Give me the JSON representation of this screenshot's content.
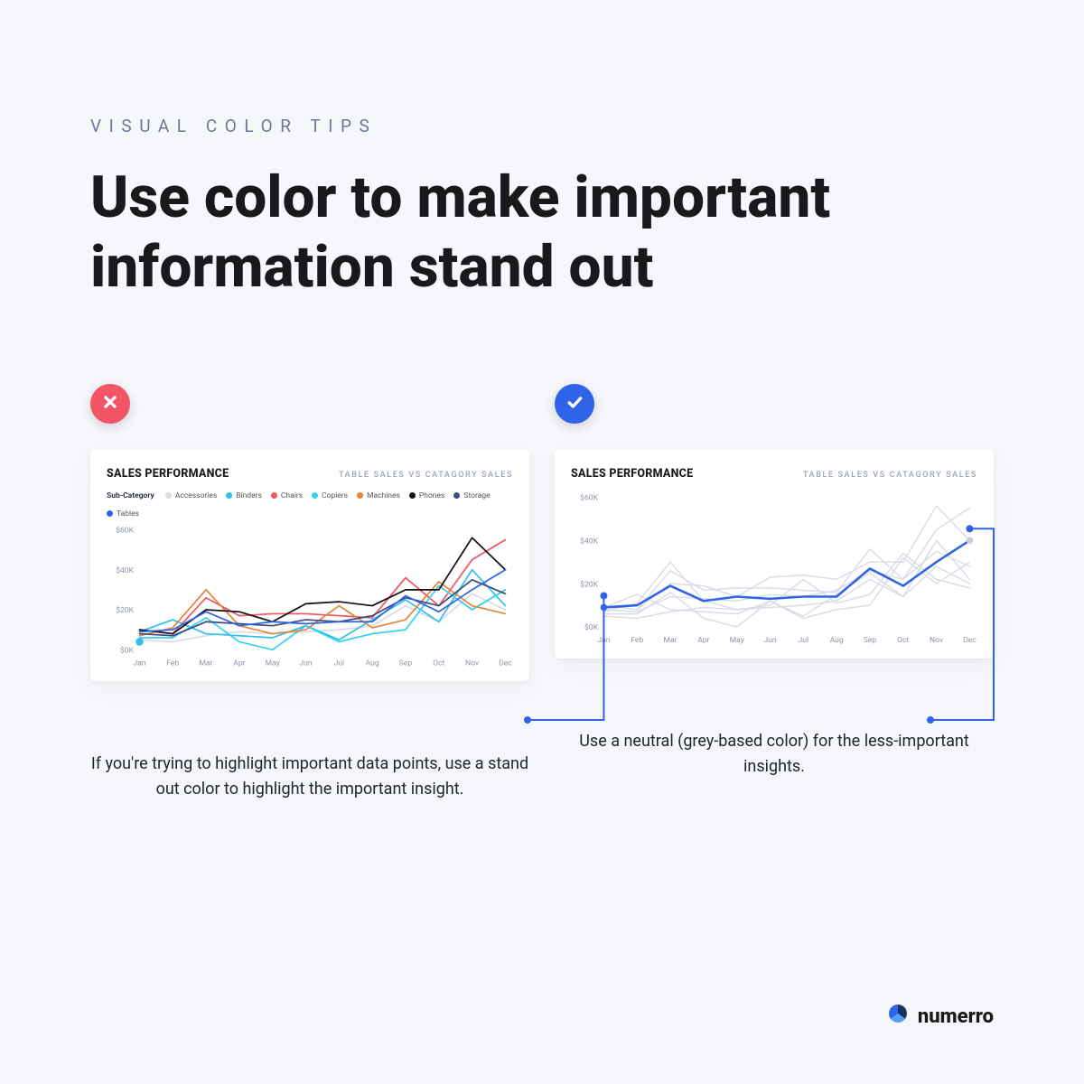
{
  "eyebrow": "VISUAL COLOR TIPS",
  "headline": "Use color to make important information stand out",
  "chart": {
    "title": "SALES PERFORMANCE",
    "subtitle": "TABLE SALES VS CATAGORY SALES",
    "legend_label": "Sub-Category"
  },
  "left": {
    "caption": "If you're trying to highlight important data points, use a stand out color to highlight the important insight."
  },
  "right": {
    "caption": "Use a neutral (grey-based color) for the less-important insights."
  },
  "brand": "numerro",
  "series_colors": {
    "Accessories": "#d7dbe6",
    "Binders": "#2fc1e9",
    "Chairs": "#f15566",
    "Copiers": "#35d0ee",
    "Machines": "#e6843a",
    "Phones": "#111111",
    "Storage": "#3f4c7a",
    "Tables": "#2f63e9"
  },
  "chart_data": {
    "type": "line",
    "title": "Sales Performance — Table Sales vs Category Sales",
    "xlabel": "",
    "ylabel": "",
    "ylim": [
      0,
      60
    ],
    "y_unit": "$K",
    "categories": [
      "Jan",
      "Feb",
      "Mar",
      "Apr",
      "May",
      "Jun",
      "Jul",
      "Aug",
      "Sep",
      "Oct",
      "Nov",
      "Dec"
    ],
    "y_ticks": [
      "$0K",
      "$20K",
      "$40K",
      "$60K"
    ],
    "series": [
      {
        "name": "Accessories",
        "values": [
          5,
          4,
          7,
          9,
          8,
          9,
          10,
          12,
          22,
          14,
          28,
          20
        ]
      },
      {
        "name": "Binders",
        "values": [
          9,
          15,
          8,
          7,
          6,
          12,
          5,
          15,
          25,
          14,
          40,
          22
        ]
      },
      {
        "name": "Chairs",
        "values": [
          10,
          8,
          26,
          17,
          18,
          18,
          17,
          16,
          36,
          22,
          45,
          55
        ]
      },
      {
        "name": "Copiers",
        "values": [
          6,
          6,
          16,
          4,
          0,
          12,
          4,
          8,
          10,
          32,
          20,
          30
        ]
      },
      {
        "name": "Machines",
        "values": [
          7,
          11,
          30,
          12,
          8,
          10,
          22,
          11,
          15,
          34,
          22,
          18
        ]
      },
      {
        "name": "Phones",
        "values": [
          10,
          8,
          20,
          19,
          14,
          23,
          24,
          22,
          30,
          30,
          56,
          40
        ]
      },
      {
        "name": "Storage",
        "values": [
          8,
          7,
          14,
          13,
          12,
          15,
          14,
          17,
          26,
          22,
          35,
          28
        ]
      },
      {
        "name": "Tables",
        "values": [
          9,
          10,
          19,
          12,
          14,
          13,
          14,
          14,
          27,
          19,
          30,
          40
        ]
      }
    ],
    "highlight_series": "Tables",
    "note": "Right-hand chart renders same data with all non-highlight series in grey."
  }
}
